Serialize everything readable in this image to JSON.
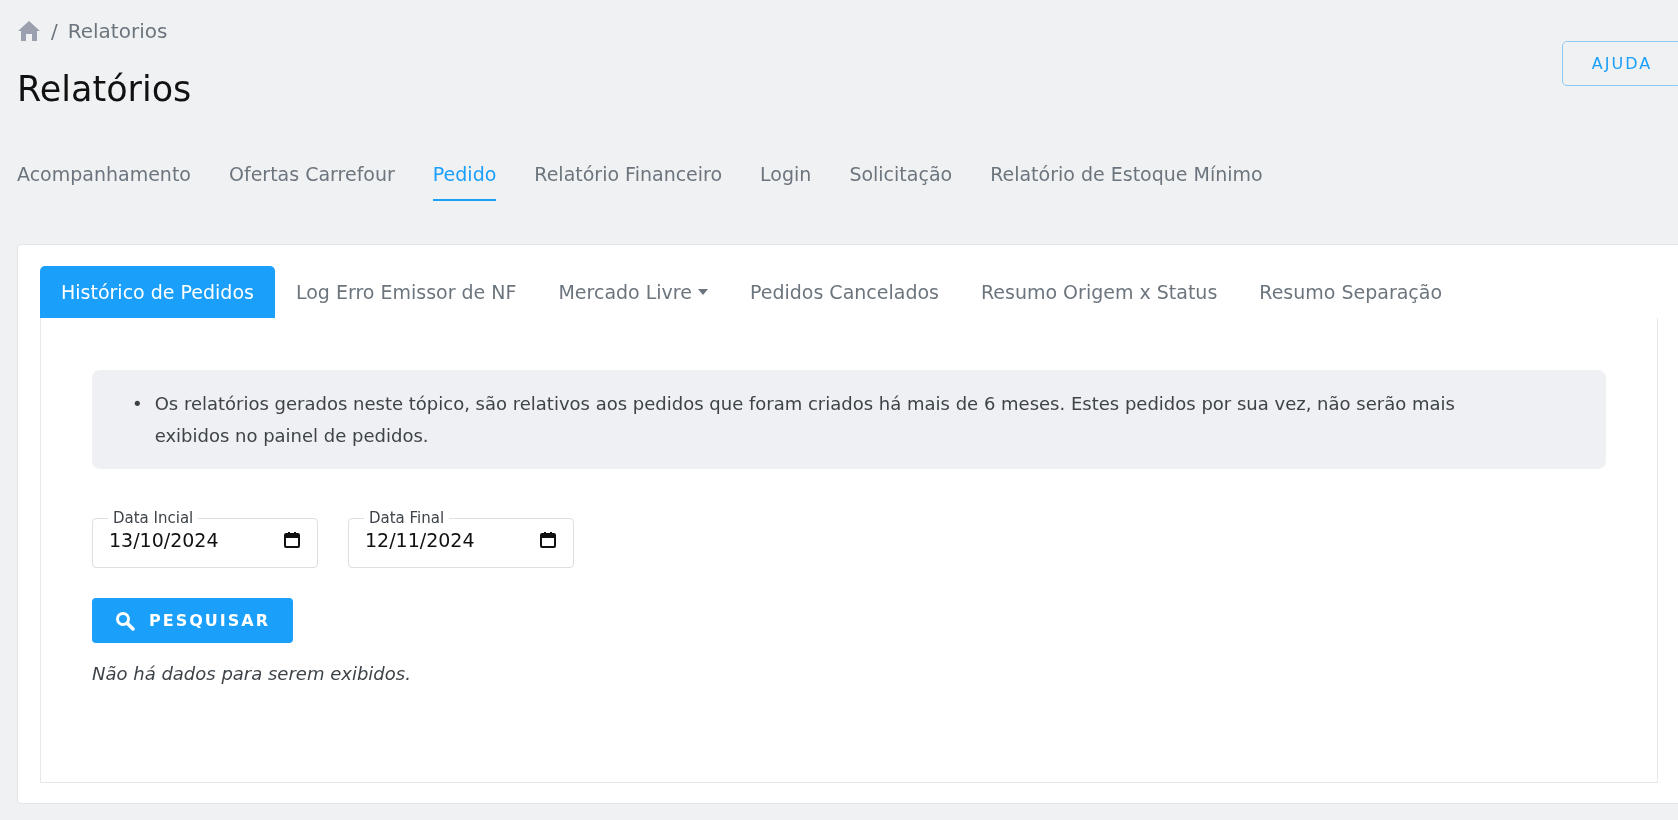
{
  "breadcrumb": {
    "separator": "/",
    "current": "Relatorios"
  },
  "page_title": "Relatórios",
  "help_button": "AJUDA",
  "top_tabs": [
    {
      "label": "Acompanhamento",
      "selected": false
    },
    {
      "label": "Ofertas Carrefour",
      "selected": false
    },
    {
      "label": "Pedido",
      "selected": true
    },
    {
      "label": "Relatório Financeiro",
      "selected": false
    },
    {
      "label": "Login",
      "selected": false
    },
    {
      "label": "Solicitação",
      "selected": false
    },
    {
      "label": "Relatório de Estoque Mínimo",
      "selected": false
    }
  ],
  "sub_tabs": [
    {
      "label": "Histórico de Pedidos",
      "selected": true,
      "kind": "plain"
    },
    {
      "label": "Log Erro Emissor de NF",
      "selected": false,
      "kind": "plain"
    },
    {
      "label": "Mercado Livre",
      "selected": false,
      "kind": "dropdown"
    },
    {
      "label": "Pedidos Cancelados",
      "selected": false,
      "kind": "plain"
    },
    {
      "label": "Resumo Origem x Status",
      "selected": false,
      "kind": "plain"
    },
    {
      "label": "Resumo Separação",
      "selected": false,
      "kind": "plain"
    }
  ],
  "info_bullet": "•",
  "info_notes": [
    "Os relatórios gerados neste tópico, são relativos aos pedidos que foram criados há mais de 6 meses. Estes pedidos por sua vez, não serão mais exibidos no painel de pedidos."
  ],
  "date_fields": [
    {
      "label": "Data Incial",
      "value": "13/10/2024"
    },
    {
      "label": "Data Final",
      "value": "12/11/2024"
    }
  ],
  "search_button": "PESQUISAR",
  "empty_message": "Não há dados para serem exibidos."
}
